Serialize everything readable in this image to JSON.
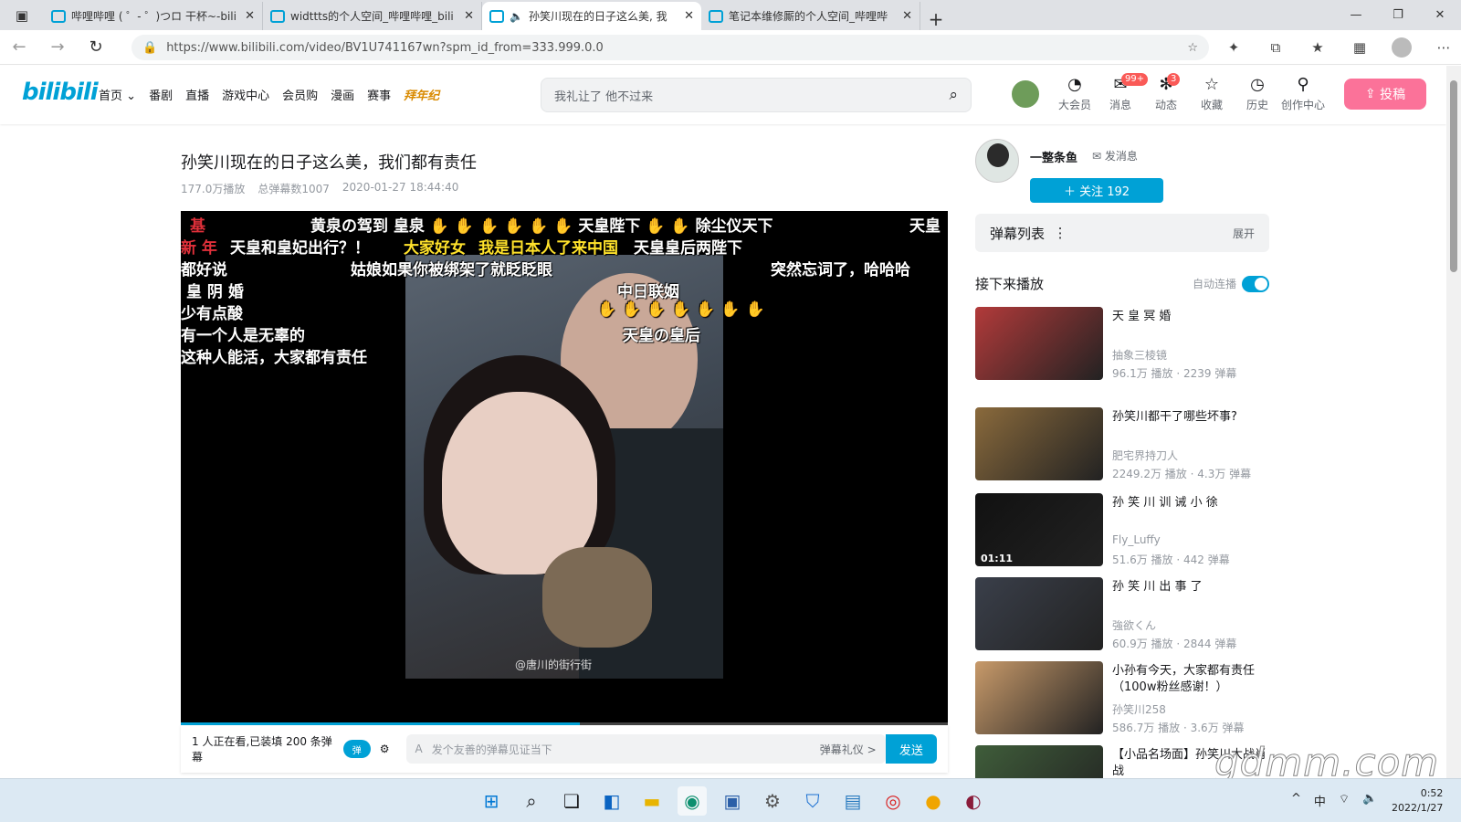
{
  "browser": {
    "tabs": [
      {
        "title": "哔哩哔哩 ( ゜- ゜)つロ 干杯~-bili"
      },
      {
        "title": "widttts的个人空间_哔哩哔哩_bili"
      },
      {
        "title": "孙笑川现在的日子这么美, 我"
      },
      {
        "title": "笔记本维修厮的个人空间_哔哩哔"
      }
    ],
    "url": "https://www.bilibili.com/video/BV1U741167wn?spm_id_from=333.999.0.0"
  },
  "header": {
    "logo": "bilibili",
    "nav": [
      "首页",
      "番剧",
      "直播",
      "游戏中心",
      "会员购",
      "漫画",
      "赛事",
      "拜年纪"
    ],
    "search_placeholder": "我礼让了 他不过来",
    "icons": [
      {
        "label": "大会员",
        "badge": ""
      },
      {
        "label": "消息",
        "badge": "99+"
      },
      {
        "label": "动态",
        "badge": "3"
      },
      {
        "label": "收藏",
        "badge": ""
      },
      {
        "label": "历史",
        "badge": ""
      },
      {
        "label": "创作中心",
        "badge": ""
      }
    ],
    "upload": "投稿"
  },
  "video": {
    "title": "孙笑川现在的日子这么美，我们都有责任",
    "views": "177.0万播放",
    "danmaku_total": "总弹幕数1007",
    "date": "2020-01-27 18:44:40",
    "watermark": "@唐川的街行街",
    "progress": 0.52,
    "danmaku": [
      {
        "text": "基",
        "color": "r"
      },
      {
        "text": "黄泉の驾到 皇泉 ✋ ✋ ✋ ✋ ✋ ✋ 天皇陛下 ✋ ✋ 除尘仪天下",
        "color": "w"
      },
      {
        "text": "天皇",
        "color": "w"
      },
      {
        "text": "新 年",
        "color": "r"
      },
      {
        "text": "天皇和皇妃出行？！",
        "color": "w"
      },
      {
        "text": "大家好女",
        "color": "y"
      },
      {
        "text": "我是日本人了来中国",
        "color": "y"
      },
      {
        "text": "天皇皇后两陛下",
        "color": "w"
      },
      {
        "text": "都好说",
        "color": "w"
      },
      {
        "text": "姑娘如果你被绑架了就眨眨眼",
        "color": "w"
      },
      {
        "text": "突然忘词了，哈哈哈",
        "color": "w"
      },
      {
        "text": "皇 阴 婚",
        "color": "w"
      },
      {
        "text": "中日联姻",
        "color": "w"
      },
      {
        "text": "少有点酸",
        "color": "w"
      },
      {
        "text": "✋ ✋ ✋ ✋ ✋ ✋ ✋",
        "color": "y"
      },
      {
        "text": "有一个人是无辜的",
        "color": "w"
      },
      {
        "text": "天皇の皇后",
        "color": "w"
      },
      {
        "text": "这种人能活，大家都有责任",
        "color": "w"
      }
    ]
  },
  "player_bar": {
    "watching": "1 人正在看,已装填 200 条弹幕",
    "toggle": "弹",
    "input_placeholder": "发个友善的弹幕见证当下",
    "etiquette": "弹幕礼仪 >",
    "send": "发送"
  },
  "uploader": {
    "name": "一整条鱼",
    "message": "发消息",
    "follow": "＋  关注 192"
  },
  "sidebar": {
    "danmaku_list": "弹幕列表",
    "expand": "展开",
    "up_next": "接下来播放",
    "autoplay": "自动连播",
    "recommendations": [
      {
        "title": "天 皇 冥 婚",
        "author": "抽象三棱镜",
        "stats": "96.1万 播放 · 2239 弹幕",
        "duration": "",
        "thumb_color": "#b23a3a"
      },
      {
        "title": "孙笑川都干了哪些坏事?",
        "author": "肥宅界持刀人",
        "stats": "2249.2万 播放 · 4.3万 弹幕",
        "duration": "",
        "thumb_color": "#8a6a3c"
      },
      {
        "title": "孙 笑 川 训 诫 小 徐",
        "author": "Fly_Luffy",
        "stats": "51.6万 播放 · 442 弹幕",
        "duration": "01:11",
        "thumb_color": "#111111"
      },
      {
        "title": "孙 笑 川 出 事 了",
        "author": "強欲くん",
        "stats": "60.9万 播放 · 2844 弹幕",
        "duration": "",
        "thumb_color": "#3a3f4a"
      },
      {
        "title": "小孙有今天，大家都有责任（100w粉丝感谢！）",
        "author": "孙笑川258",
        "stats": "586.7万 播放 · 3.6万 弹幕",
        "duration": "",
        "thumb_color": "#c89a6a"
      },
      {
        "title": "【小品名场面】孙笑川大战肖战",
        "author": "",
        "stats": "",
        "duration": "",
        "thumb_color": "#3f5d3a"
      }
    ]
  },
  "taskbar": {
    "tray": [
      "^",
      "中",
      "wifi",
      "vol"
    ],
    "time": "0:52",
    "date": "2022/1/27"
  },
  "site_watermark": "gdmm.com"
}
